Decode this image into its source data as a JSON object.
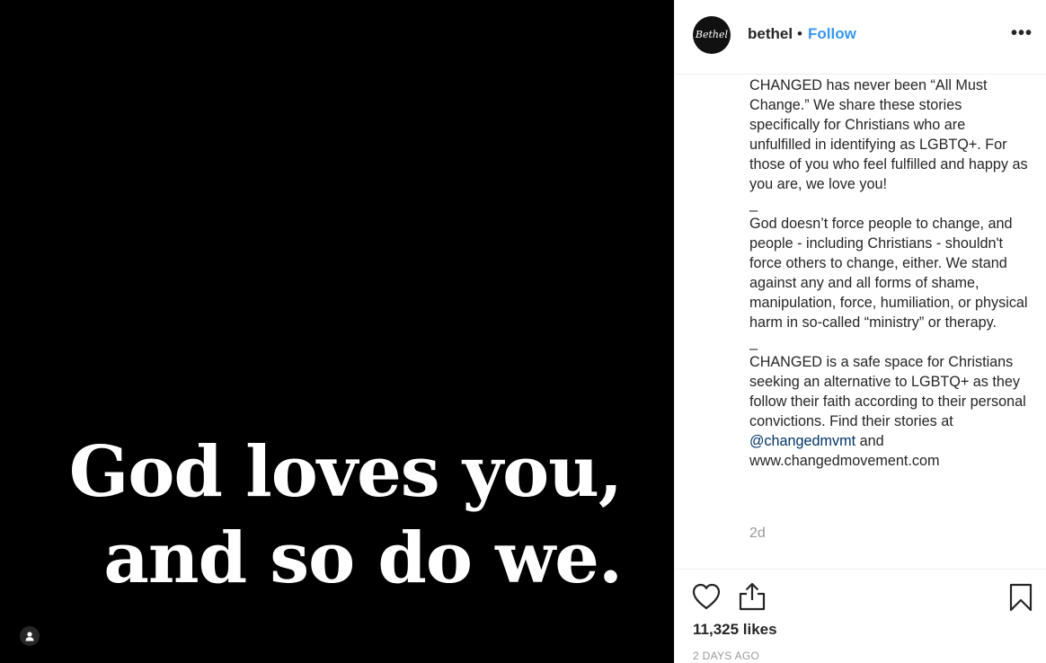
{
  "media": {
    "line1": "God loves you,",
    "line2": "and so do we."
  },
  "header": {
    "avatar_text": "Bethel",
    "username": "bethel",
    "separator": "•",
    "follow_label": "Follow",
    "more_label": "•••"
  },
  "caption": {
    "p1": "CHANGED has never been “All Must Change.” We share these stories specifically for Christians who are unfulfilled in identifying as LGBTQ+. For those of you who feel fulfilled and happy as you are, we love you!",
    "sep1": "_",
    "p2": "God doesn’t force people to change, and people - including Christians - shouldn't force others to change, either. We stand against any and all forms of shame, manipulation, force, humiliation, or physical harm in so-called “ministry” or therapy.",
    "sep2": "_",
    "p3": "CHANGED is a safe space for Christians seeking an alternative to LGBTQ+ as they follow their faith according to their personal convictions. Find their stories at ",
    "mention": "@changedmvmt",
    "p3_end": " and",
    "url": "www.changedmovement.com",
    "time_short": "2d"
  },
  "footer": {
    "likes": "11,325 likes",
    "date": "2 DAYS AGO"
  },
  "icons": {
    "like": "heart-icon",
    "share": "share-icon",
    "save": "bookmark-icon",
    "tag": "user-tag-icon",
    "more": "more-options-icon"
  },
  "colors": {
    "follow": "#3897f0",
    "media_bg": "#000000",
    "muted": "#999999"
  }
}
